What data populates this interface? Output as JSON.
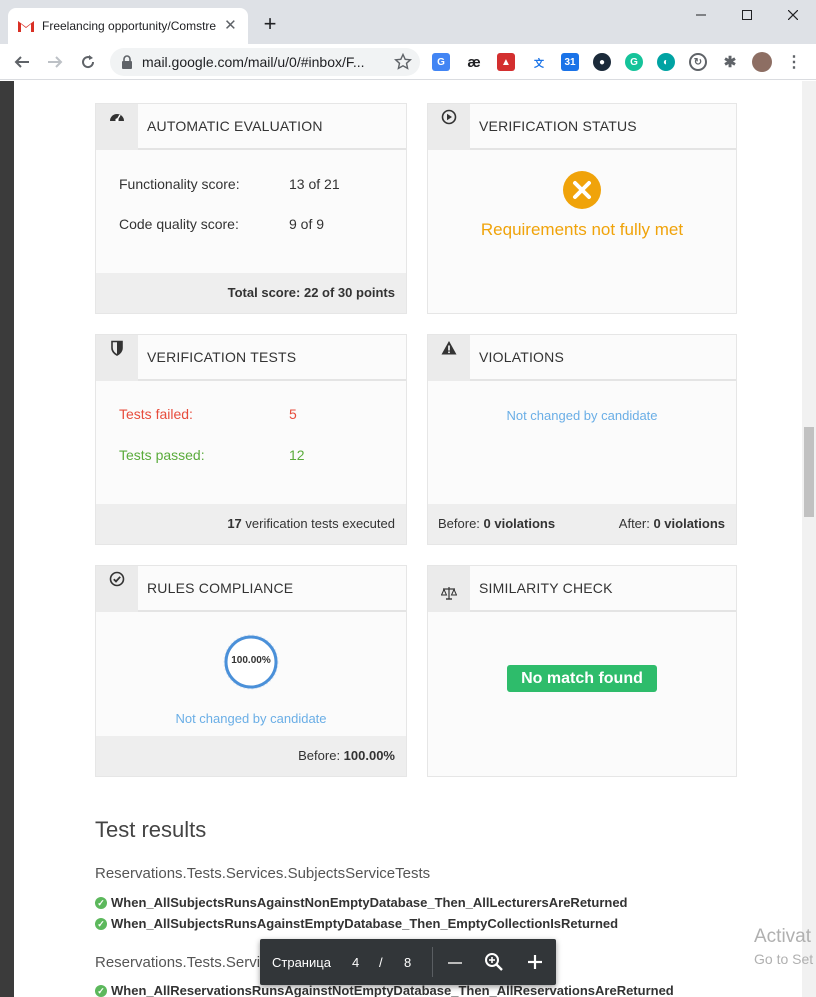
{
  "browser": {
    "tab_title": "Freelancing opportunity/Comstre",
    "new_tab_label": "+",
    "url": "mail.google.com/mail/u/0/#inbox/F..."
  },
  "cards": {
    "auto_eval": {
      "title": "AUTOMATIC EVALUATION",
      "functionality_label": "Functionality score:",
      "functionality_value": "13 of 21",
      "quality_label": "Code quality score:",
      "quality_value": "9 of 9",
      "total": "Total score: 22 of 30 points"
    },
    "verification_status": {
      "title": "VERIFICATION STATUS",
      "status_text": "Requirements not fully met"
    },
    "verification_tests": {
      "title": "VERIFICATION TESTS",
      "failed_label": "Tests failed:",
      "failed_value": "5",
      "passed_label": "Tests passed:",
      "passed_value": "12",
      "executed_count": "17",
      "executed_text": " verification tests executed"
    },
    "violations": {
      "title": "VIOLATIONS",
      "note": "Not changed by candidate",
      "before_label": "Before: ",
      "before_value": "0 violations",
      "after_label": "After: ",
      "after_value": "0 violations"
    },
    "rules": {
      "title": "RULES COMPLIANCE",
      "percent": "100.00%",
      "percent_fraction": 1.0,
      "note": "Not changed by candidate",
      "before_label": "Before: ",
      "before_value": "100.00%"
    },
    "similarity": {
      "title": "SIMILARITY CHECK",
      "badge": "No match found"
    }
  },
  "results": {
    "heading": "Test results",
    "suite1": "Reservations.Tests.Services.SubjectsServiceTests",
    "suite1_tests": [
      "When_AllSubjectsRunsAgainstNonEmptyDatabase_Then_AllLecturersAreReturned",
      "When_AllSubjectsRunsAgainstEmptyDatabase_Then_EmptyCollectionIsReturned"
    ],
    "suite2_left": "Reservations.Tests.Servic",
    "suite2_right": "sTests",
    "suite2_tests": [
      "When_AllReservationsRunsAgainstNotEmptyDatabase_Then_AllReservationsAreReturned"
    ]
  },
  "pdf_toolbar": {
    "page_label": "Страница",
    "current_page": "4",
    "separator": "/",
    "total_pages": "8"
  },
  "watermark": {
    "line1": "Activat",
    "line2": "Go to Set"
  },
  "colors": {
    "fail_red": "#e74c3c",
    "pass_green": "#5aab3b",
    "warning_orange": "#f0a30a",
    "link_blue": "#6aaee6",
    "badge_green": "#2ebc6b",
    "ring_blue": "#4a90d9"
  }
}
